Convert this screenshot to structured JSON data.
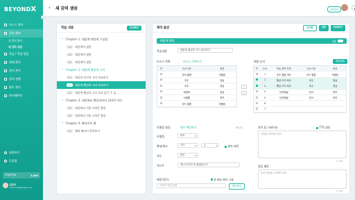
{
  "sidebar": {
    "logo_main": "BEYOND",
    "logo_x": "X",
    "collapse_icon": "«",
    "items": [
      {
        "label": "미스스 관리",
        "icon": "home-icon"
      },
      {
        "label": "강의 관리",
        "icon": "book-icon"
      },
      {
        "label": "내 강의 관리",
        "sub": true
      },
      {
        "label": "새 강의 생성",
        "sub": true
      },
      {
        "label": "학급 / 학생 동동",
        "icon": "users-icon"
      },
      {
        "label": "과제 관리",
        "icon": "task-icon"
      },
      {
        "label": "강의 관리",
        "icon": "class-icon"
      },
      {
        "label": "강의 실행",
        "icon": "play-icon"
      },
      {
        "label": "평가 관리",
        "icon": "chart-icon"
      },
      {
        "label": "마이페이지",
        "icon": "person-icon"
      }
    ],
    "bottom_items": [
      {
        "label": "설정하기",
        "icon": "settings-icon"
      },
      {
        "label": "도움말",
        "icon": "help-icon"
      }
    ],
    "points_label": "보유포인트",
    "points_value": "3,000",
    "user_name": "김교수",
    "user_email": "beyondx@sample.com"
  },
  "topbar": {
    "back_icon": "‹",
    "title": "새 강의 생성",
    "badge": "강의하기",
    "language": "korea-flag-icon"
  },
  "left_panel": {
    "title": "학습 내용",
    "add_button": "추가하기",
    "chapters": [
      {
        "label": "Chapter 1. 태양계 태양계 구성원",
        "active": false,
        "lessons": [
          {
            "num": "1-1",
            "label": "태양계의 설명",
            "active": false
          },
          {
            "num": "1-2",
            "label": "태양계의 설명",
            "active": false
          },
          {
            "num": "1-3",
            "label": "태양계의 설명",
            "active": false
          }
        ]
      },
      {
        "label": "Chapter 2. 태양계 행성의 크기",
        "active": true,
        "lessons": [
          {
            "num": "2-1",
            "label": "태양과 지구의 크기 비교하기",
            "active": false
          },
          {
            "num": "2-2",
            "label": "태양계 행성의 크기 비교하기",
            "active": true
          },
          {
            "num": "2-3",
            "label": "태양계 행성의 크기 비교 탐구 수 있 ...",
            "active": false
          }
        ]
      },
      {
        "label": "Chapter 3. 태양에서 행성까지의 상대적 거리",
        "active": false,
        "lessons": [
          {
            "num": "3-1",
            "label": "태양에서 가장 가까운 행성",
            "active": false
          },
          {
            "num": "3-2",
            "label": "태양에서 가장 가까운 행성",
            "active": false
          }
        ]
      },
      {
        "label": "Chapter 4. 별자리의 별",
        "active": false,
        "lessons": [
          {
            "num": "4-1",
            "label": "별과 별자리 찾아보기",
            "active": false
          }
        ]
      }
    ]
  },
  "right_panel": {
    "title": "제작 옵션",
    "btn_reset": "초기화",
    "btn_save": "저장",
    "btn_preview": "미리보기",
    "section_bar": "태양계 행성",
    "section_toggle": "공개",
    "learn_label": "학습내용",
    "learn_value": "태양계 행성의 크기 비교하기",
    "resource_label": "리소스 목록",
    "resource_link": "리소스 가져오기",
    "problem_label": "제생 순서",
    "problem_btn": "학습문제",
    "resources_head": [
      "",
      "리소스명",
      "종류"
    ],
    "resources": [
      {
        "name": "우드/얼음",
        "type": "모델링"
      },
      {
        "name": "우주",
        "type": "영상"
      },
      {
        "name": "우주",
        "type": "영상"
      },
      {
        "name": "태양계",
        "type": "영상"
      },
      {
        "name": "쇠배행",
        "type": "퀴즈"
      },
      {
        "name": "우드 얼음",
        "type": "모델링"
      }
    ],
    "order_head": [
      "",
      "순서",
      "학습 제목 차정",
      "리소스명",
      "종류"
    ],
    "order": [
      {
        "n": "1",
        "title": "우도 얼음 개요",
        "res": "우드 얼음",
        "type": "모델링",
        "hl": false
      },
      {
        "n": "2",
        "title": "행성 크기 비교",
        "res": "우주",
        "type": "영상",
        "hl": true
      },
      {
        "n": "3",
        "title": "행성 크기 비교",
        "res": "우주",
        "type": "영상",
        "hl": true
      },
      {
        "n": "4",
        "title": "단어해설",
        "res": "단어",
        "type": "퀴즈",
        "hl": false
      },
      {
        "n": "5",
        "title": "단어해설",
        "res": "단어",
        "type": "퀴즈",
        "hl": false
      },
      {
        "n": "6",
        "title": "",
        "res": "",
        "type": "",
        "hl": false
      },
      {
        "n": "7",
        "title": "",
        "res": "",
        "type": "",
        "hl": false
      }
    ],
    "model_label": "모델링 설정",
    "model_link": "퀴즈 확인하기",
    "model_count": "총 0개",
    "rotate_label": "모델링",
    "rotate_value": "위치",
    "scale_label": "확대/축소",
    "scale_value": "크기",
    "pos_label": "위치",
    "pos_value": "3",
    "auto_rotate": "계속 회전",
    "speed_label": "속도",
    "speed_value": "중간",
    "text_label": "텍스트",
    "text_value": "에니아 부여 일 될겠습니다.",
    "caption_label": "자막 및 나레이션",
    "tts_label": "TTS 생성",
    "caption_count": "0 / 500",
    "caption_placeholder": "내용을 입력해주세요",
    "answer_label": "정답 예문",
    "answer_count": "0 / 500",
    "answer_placeholder": "정답 예문을 입력해주세요",
    "bgm_label": "배경사운드",
    "bgm_check": "한 배정 사운드 사용",
    "bgm_input": "신택된 파일 없음",
    "bgm_btn": "찾아보기"
  }
}
